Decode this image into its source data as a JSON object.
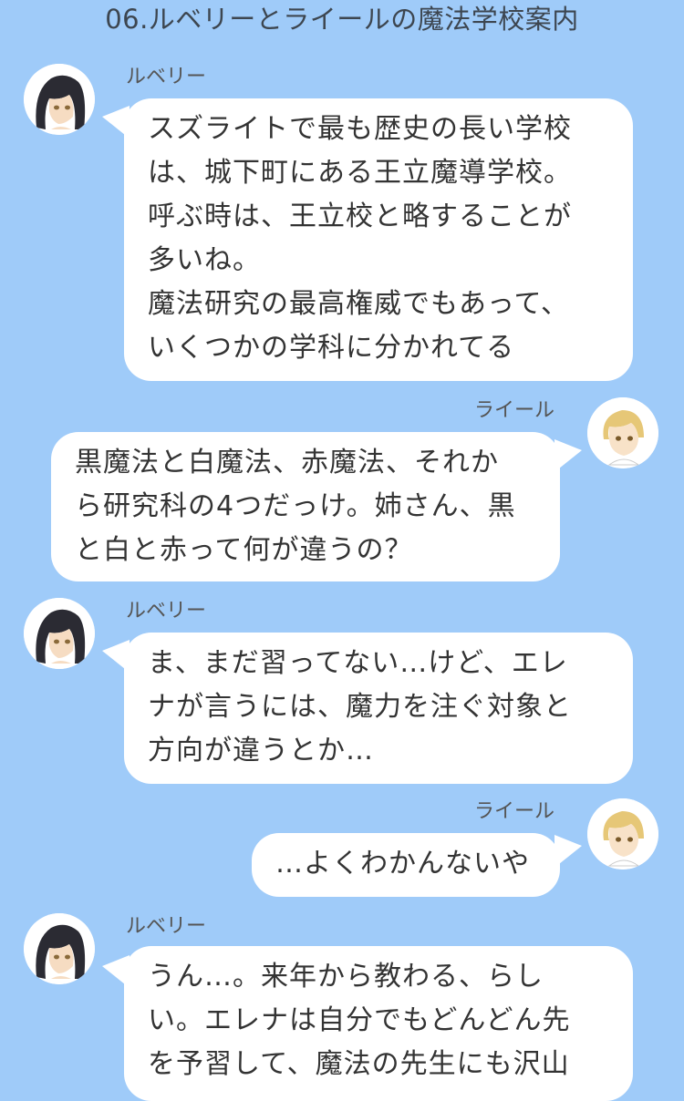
{
  "header": {
    "title": "06.ルベリーとライールの魔法学校案内"
  },
  "messages": [
    {
      "speaker": "ルベリー",
      "side": "left",
      "avatar_icon": "dark-haired-girl-avatar",
      "text": "スズライトで最も歴史の長い学校\nは、城下町にある王立魔導学校。\n呼ぶ時は、王立校と略することが\n多いね。\n魔法研究の最高権威でもあって、\nいくつかの学科に分かれてる"
    },
    {
      "speaker": "ライール",
      "side": "right",
      "avatar_icon": "blond-boy-avatar",
      "text": "黒魔法と白魔法、赤魔法、それか\nら研究科の4つだっけ。姉さん、黒\nと白と赤って何が違うの？"
    },
    {
      "speaker": "ルベリー",
      "side": "left",
      "avatar_icon": "dark-haired-girl-avatar",
      "text": "ま、まだ習ってない…けど、エレ\nナが言うには、魔力を注ぐ対象と\n方向が違うとか…"
    },
    {
      "speaker": "ライール",
      "side": "right",
      "avatar_icon": "blond-boy-avatar",
      "text": "…よくわかんないや"
    },
    {
      "speaker": "ルベリー",
      "side": "left",
      "avatar_icon": "dark-haired-girl-avatar",
      "text": "うん…。来年から教わる、らし\nい。エレナは自分でもどんどん先\nを予習して、魔法の先生にも沢山"
    }
  ],
  "colors": {
    "background": "#9fcbf9",
    "bubble": "#ffffff",
    "text": "#333333"
  }
}
